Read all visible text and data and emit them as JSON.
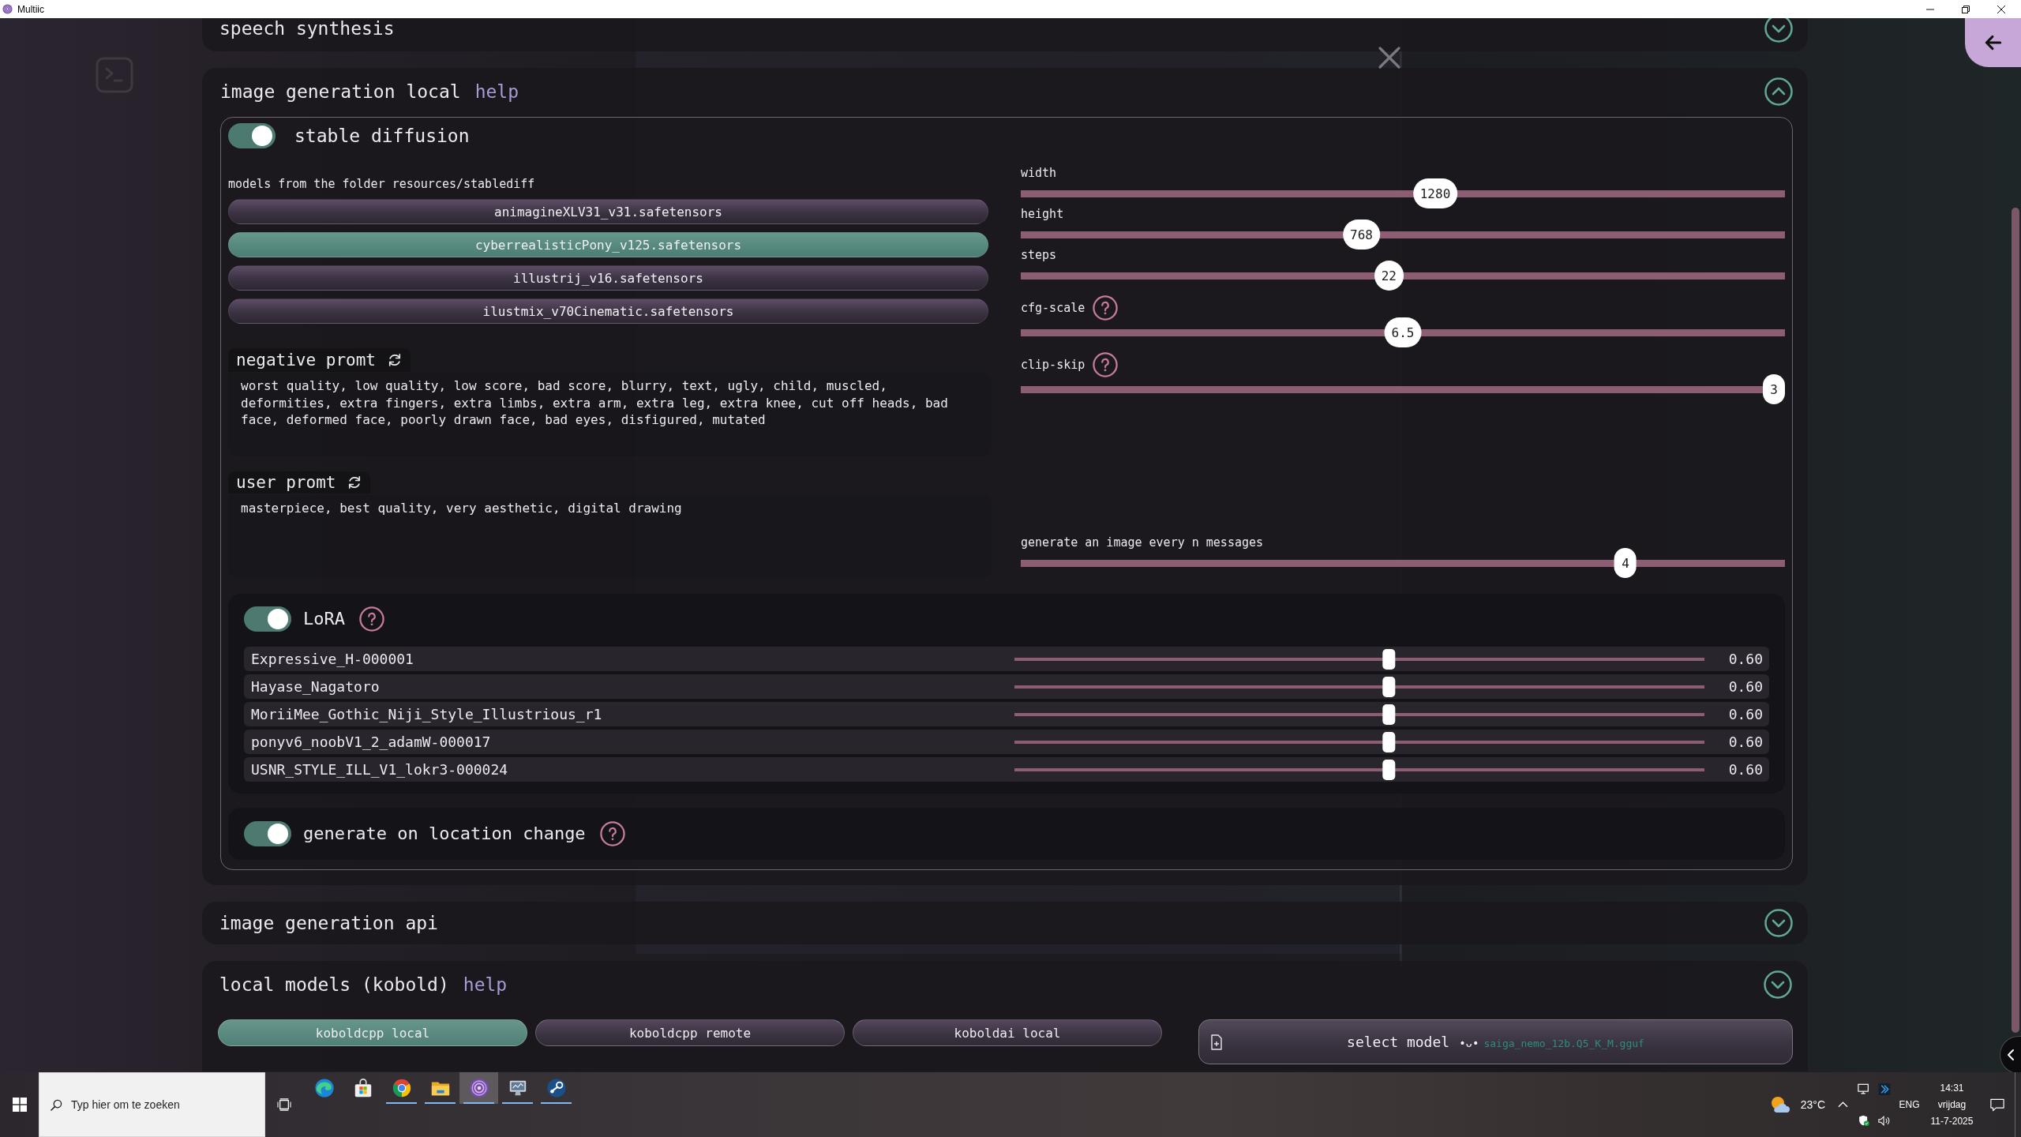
{
  "window": {
    "title": "Multiic"
  },
  "speech_synthesis": {
    "title": "speech synthesis",
    "expanded": false
  },
  "image_generation_local": {
    "title": "image generation local",
    "help": "help",
    "expanded": true,
    "stable_diffusion": {
      "label": "stable diffusion",
      "on": true
    },
    "models": {
      "caption": "models from the folder resources/stablediff",
      "items": [
        {
          "name": "animagineXLV31_v31.safetensors",
          "selected": false
        },
        {
          "name": "cyberrealisticPony_v125.safetensors",
          "selected": true
        },
        {
          "name": "illustrij_v16.safetensors",
          "selected": false
        },
        {
          "name": "ilustmix_v70Cinematic.safetensors",
          "selected": false
        }
      ]
    },
    "negative_prompt": {
      "label": "negative promt",
      "value": "worst quality, low quality, low score, bad score, blurry, text, ugly, child, muscled, deformities, extra fingers, extra limbs, extra arm, extra leg, extra knee, cut off heads, bad face, deformed face, poorly drawn face, bad eyes, disfigured, mutated"
    },
    "user_prompt": {
      "label": "user promt",
      "value": "masterpiece, best quality, very aesthetic, digital drawing"
    },
    "sliders": [
      {
        "label": "width",
        "help": false,
        "reading": "1280",
        "level": 0.545
      },
      {
        "label": "height",
        "help": false,
        "reading": "768",
        "level": 0.443
      },
      {
        "label": "steps",
        "help": false,
        "reading": "22",
        "level": 0.481
      },
      {
        "label": "cfg-scale",
        "help": true,
        "reading": "6.5",
        "level": 0.5
      },
      {
        "label": "clip-skip",
        "help": true,
        "reading": "3",
        "level": 1.0
      }
    ],
    "every_n": {
      "label": "generate an image every n messages",
      "reading": "4",
      "level": 0.8
    },
    "lora": {
      "label": "LoRA",
      "on": true,
      "help": true,
      "items": [
        {
          "name": "Expressive_H-000001",
          "reading": "0.60",
          "level": 0.544
        },
        {
          "name": "Hayase_Nagatoro",
          "reading": "0.60",
          "level": 0.544
        },
        {
          "name": "MoriiMee_Gothic_Niji_Style_Illustrious_r1",
          "reading": "0.60",
          "level": 0.544
        },
        {
          "name": "ponyv6_noobV1_2_adamW-000017",
          "reading": "0.60",
          "level": 0.544
        },
        {
          "name": "USNR_STYLE_ILL_V1_lokr3-000024",
          "reading": "0.60",
          "level": 0.544
        }
      ]
    },
    "location_change": {
      "label": "generate on location change",
      "on": true,
      "help": true
    }
  },
  "image_generation_api": {
    "title": "image generation api",
    "expanded": false
  },
  "local_models": {
    "title": "local models (kobold)",
    "help": "help",
    "expanded": false,
    "backends": [
      {
        "label": "koboldcpp local",
        "selected": true
      },
      {
        "label": "koboldcpp remote",
        "selected": false
      },
      {
        "label": "koboldai local",
        "selected": false
      }
    ],
    "select_model": {
      "label": "select model",
      "face": "•ᴗ•",
      "model": "saiga_nemo_12b.Q5_K_M.gguf"
    }
  },
  "taskbar": {
    "search": {
      "placeholder": "Typ hier om te zoeken"
    },
    "apps": [
      {
        "kind": "browser",
        "running": false,
        "selected": false
      },
      {
        "kind": "store",
        "running": false,
        "selected": false
      },
      {
        "kind": "web",
        "running": true,
        "selected": false
      },
      {
        "kind": "files",
        "running": true,
        "selected": false
      },
      {
        "kind": "app",
        "running": true,
        "selected": true
      },
      {
        "kind": "monitor",
        "running": true,
        "selected": false
      },
      {
        "kind": "game",
        "running": true,
        "selected": false
      }
    ],
    "weather": "23°C",
    "language": "ENG",
    "clock": {
      "time": "14:31",
      "day": "vrijdag",
      "date": "11-7-2025"
    }
  }
}
